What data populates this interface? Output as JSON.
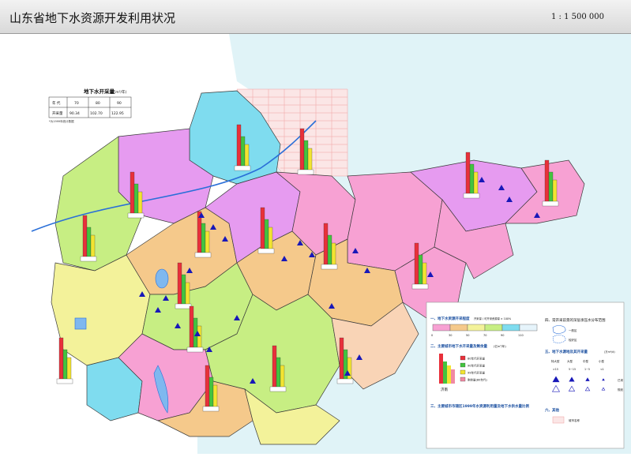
{
  "header": {
    "title": "山东省地下水资源开发利用状况",
    "scale": "1 : 1 500 000"
  },
  "table": {
    "title": "地下水开采量",
    "unit": "(亿m³/年)",
    "header_label": "年 代",
    "header_values": [
      "70",
      "80",
      "90"
    ],
    "row_label": "开采量",
    "row_values": [
      "90.34",
      "102.70",
      "122.95"
    ],
    "note": "*为1999年统计数据"
  },
  "legend": {
    "section1": "一、地下水资源开采程度",
    "section1_note": "开采量 / 可开采资源量 × 100%",
    "section1_colors": [
      "#f7a1d3",
      "#f5c98b",
      "#f3f29a",
      "#c7ee83",
      "#7fdcef",
      "#e6f4fb"
    ],
    "section1_ticks": [
      "0",
      "30",
      "50",
      "70",
      "90",
      "110"
    ],
    "section2": "二、主要城市地下水开采量及剩余量",
    "section2_unit": "(亿m³/年)",
    "section2_items": [
      "80年代开采量",
      "90年代开采量",
      "99年代开采量",
      "剩余量(80年代)"
    ],
    "section2_city": "济南",
    "section3": "三、主要城市市辖区1999年水资源利用量及地下水供水量比例",
    "section4": "四、常开采前景的深层承压水分布范围",
    "section4_items": [
      "一般区",
      "较好区"
    ],
    "section5": "五、地下水源地及其开采量",
    "section5_unit": "(万m³/d)",
    "section5_cols": [
      "特大型",
      "大型",
      "中型",
      "小型"
    ],
    "section5_ranges": [
      ">15",
      "5~15",
      "1~5",
      "<1"
    ],
    "section5_rows": [
      "已采",
      "规划"
    ],
    "section6": "六、其他",
    "section6_items": [
      "城市名称"
    ]
  },
  "colors": {
    "sea": "#e0f3f7",
    "land_outline": "#1a1a1a",
    "pink": "#f7a1d3",
    "orange": "#f5c98b",
    "yellow": "#f3f29a",
    "green": "#c7ee83",
    "cyan": "#7fdcef",
    "magenta": "#e69bf0",
    "peach": "#f9d4b6",
    "triangle": "#1818b8",
    "bar_red": "#e8303a",
    "bar_green": "#43c43f",
    "bar_yellow": "#f2e431",
    "bar_pink": "#f08aa4"
  }
}
